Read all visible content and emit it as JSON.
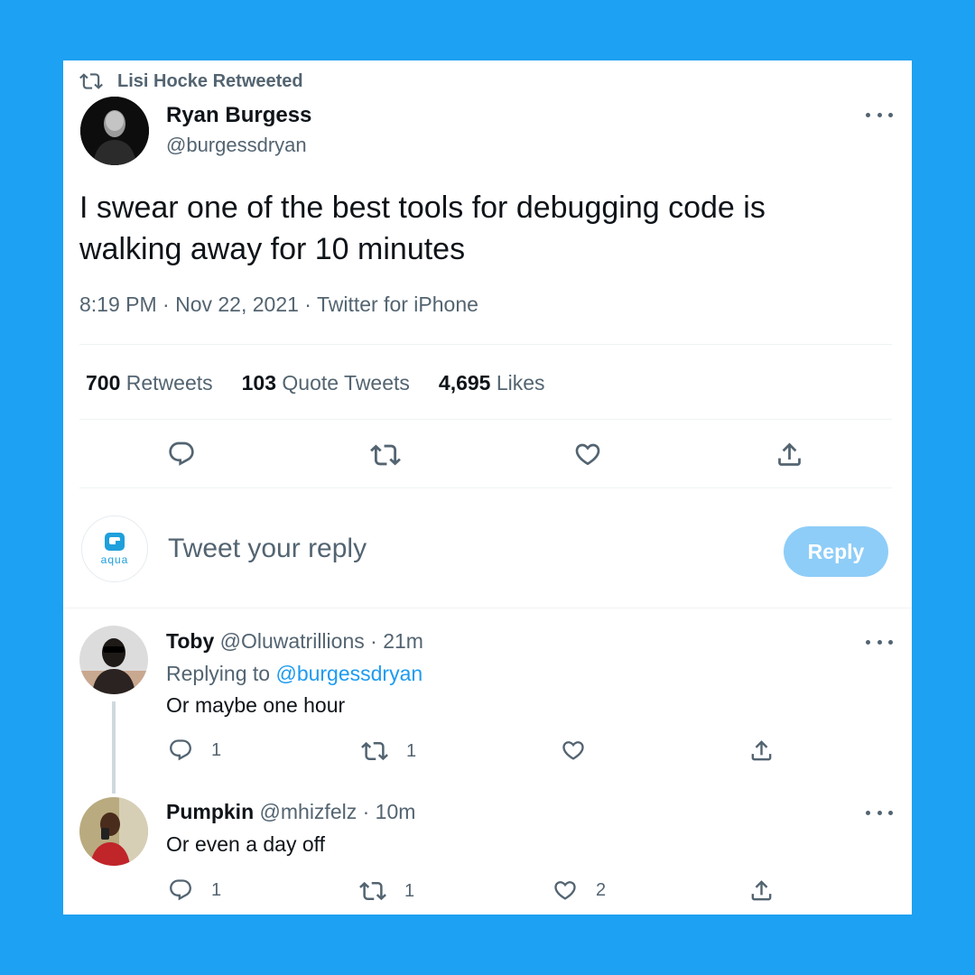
{
  "retweet_context": {
    "text": "Lisi Hocke Retweeted",
    "icon": "retweet-icon"
  },
  "tweet": {
    "author_name": "Ryan Burgess",
    "author_handle": "@burgessdryan",
    "text": "I swear one of the best tools for debugging code is walking away for 10 minutes",
    "meta": "8:19 PM · Nov 22, 2021 · Twitter for iPhone",
    "stats": [
      {
        "value": "700",
        "label": "Retweets"
      },
      {
        "value": "103",
        "label": "Quote Tweets"
      },
      {
        "value": "4,695",
        "label": "Likes"
      }
    ],
    "actions": [
      "reply-icon",
      "retweet-icon",
      "like-icon",
      "share-icon"
    ]
  },
  "composer": {
    "placeholder": "Tweet your reply",
    "button_label": "Reply",
    "avatar_text": "aqua"
  },
  "replies": [
    {
      "name": "Toby",
      "handle": "@Oluwatrillions",
      "time": "· 21m",
      "replying_label": "Replying to",
      "replying_to": "@burgessdryan",
      "text": "Or maybe one hour",
      "counts": {
        "reply": "1",
        "retweet": "1",
        "like": ""
      }
    },
    {
      "name": "Pumpkin",
      "handle": "@mhizfelz",
      "time": "· 10m",
      "text": "Or even a day off",
      "counts": {
        "reply": "1",
        "retweet": "1",
        "like": "2"
      }
    }
  ],
  "colors": {
    "background": "#1DA1F2",
    "accent": "#1d9bf0",
    "reply_button_disabled": "#8ecdf8",
    "muted_text": "#536471"
  }
}
